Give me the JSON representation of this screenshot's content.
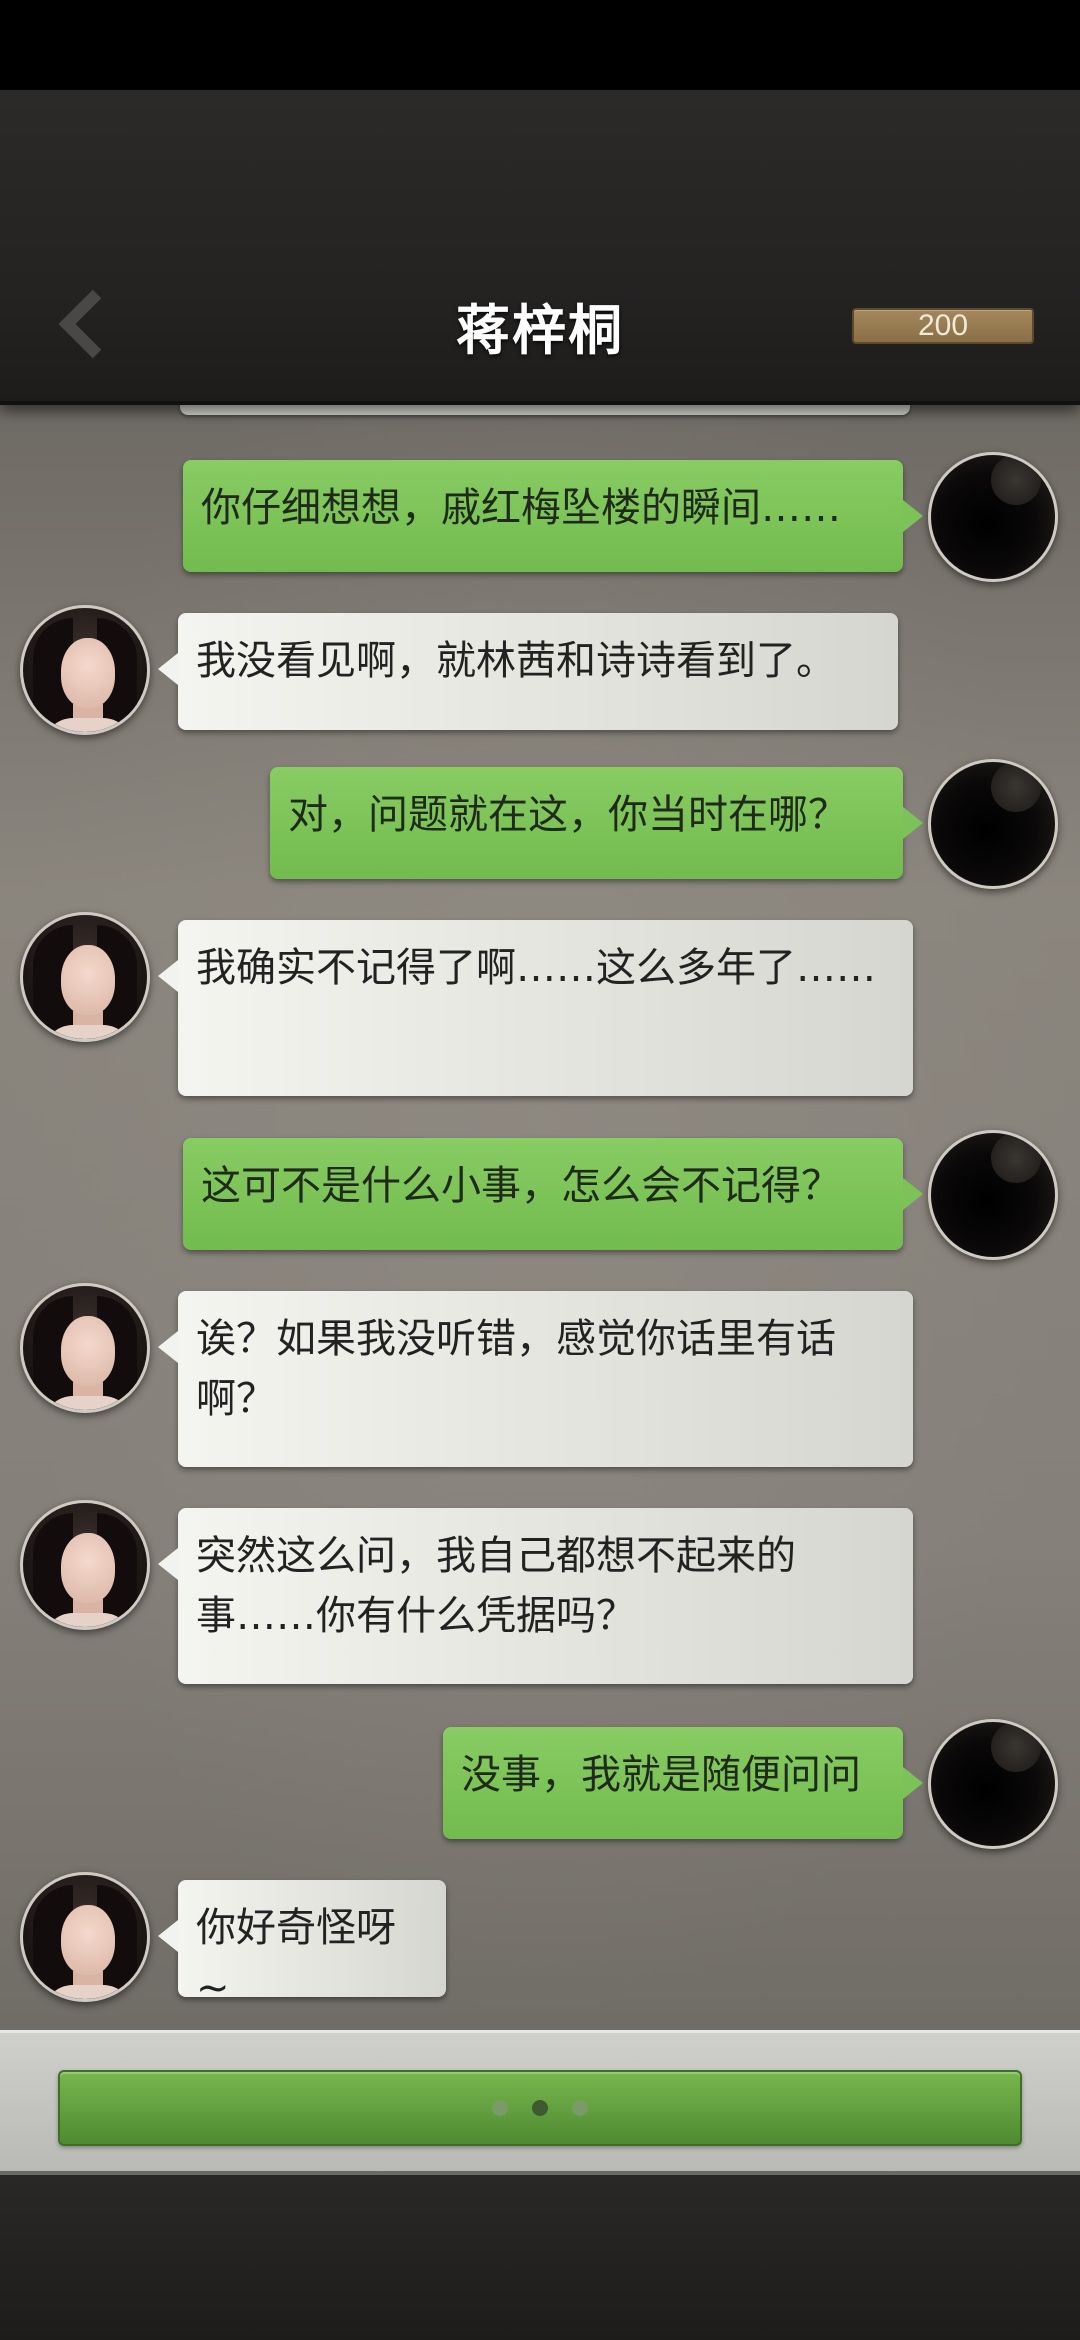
{
  "header": {
    "title": "蒋梓桐",
    "coins": "200",
    "back_icon": "chevron-left-icon"
  },
  "messages": [
    {
      "sender": "player",
      "text": "你仔细想想，戚红梅坠楼的瞬间……"
    },
    {
      "sender": "npc",
      "text": "我没看见啊，就林茜和诗诗看到了。"
    },
    {
      "sender": "player",
      "text": "对，问题就在这，你当时在哪？"
    },
    {
      "sender": "npc",
      "text": "我确实不记得了啊……这么多年了……"
    },
    {
      "sender": "player",
      "text": "这可不是什么小事，怎么会不记得？"
    },
    {
      "sender": "npc",
      "text": "诶？如果我没听错，感觉你话里有话啊？"
    },
    {
      "sender": "npc",
      "text": "突然这么问，我自己都想不起来的事……你有什么凭据吗？"
    },
    {
      "sender": "player",
      "text": "没事，我就是随便问问"
    },
    {
      "sender": "npc",
      "text": "你好奇怪呀~"
    }
  ],
  "reply": {
    "typing_indicator": "• • •"
  },
  "colors": {
    "player_bubble": "#7dc259",
    "npc_bubble": "#ececE8",
    "coin_badge": "#9a7e52"
  }
}
